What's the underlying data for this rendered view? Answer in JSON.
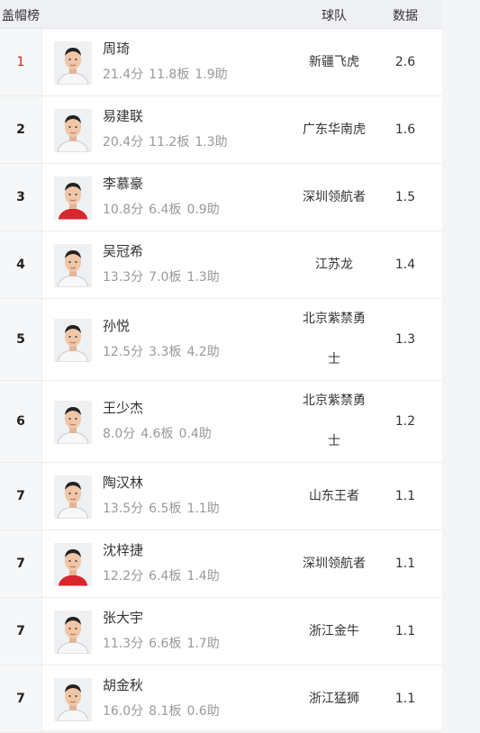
{
  "header": {
    "rank_title": "盖帽榜",
    "team_title": "球队",
    "stat_title": "数据"
  },
  "colors": {
    "top_rank": "#c0262c",
    "stat_text": "#999999",
    "header_bg": "#eef0f3"
  },
  "rows": [
    {
      "rank": "1",
      "name": "周琦",
      "pts": "21.4分",
      "reb": "11.8板",
      "ast": "1.9助",
      "team": "新疆飞虎",
      "stat": "2.6",
      "jersey": "white"
    },
    {
      "rank": "2",
      "name": "易建联",
      "pts": "20.4分",
      "reb": "11.2板",
      "ast": "1.3助",
      "team": "广东华南虎",
      "stat": "1.6",
      "jersey": "white"
    },
    {
      "rank": "3",
      "name": "李慕豪",
      "pts": "10.8分",
      "reb": "6.4板",
      "ast": "0.9助",
      "team": "深圳领航者",
      "stat": "1.5",
      "jersey": "red"
    },
    {
      "rank": "4",
      "name": "吴冠希",
      "pts": "13.3分",
      "reb": "7.0板",
      "ast": "1.3助",
      "team": "江苏龙",
      "stat": "1.4",
      "jersey": "white"
    },
    {
      "rank": "5",
      "name": "孙悦",
      "pts": "12.5分",
      "reb": "3.3板",
      "ast": "4.2助",
      "team": "北京紫禁勇士",
      "stat": "1.3",
      "jersey": "white"
    },
    {
      "rank": "6",
      "name": "王少杰",
      "pts": "8.0分",
      "reb": "4.6板",
      "ast": "0.4助",
      "team": "北京紫禁勇士",
      "stat": "1.2",
      "jersey": "white"
    },
    {
      "rank": "7",
      "name": "陶汉林",
      "pts": "13.5分",
      "reb": "6.5板",
      "ast": "1.1助",
      "team": "山东王者",
      "stat": "1.1",
      "jersey": "white"
    },
    {
      "rank": "7",
      "name": "沈梓捷",
      "pts": "12.2分",
      "reb": "6.4板",
      "ast": "1.4助",
      "team": "深圳领航者",
      "stat": "1.1",
      "jersey": "red"
    },
    {
      "rank": "7",
      "name": "张大宇",
      "pts": "11.3分",
      "reb": "6.6板",
      "ast": "1.7助",
      "team": "浙江金牛",
      "stat": "1.1",
      "jersey": "white"
    },
    {
      "rank": "7",
      "name": "胡金秋",
      "pts": "16.0分",
      "reb": "8.1板",
      "ast": "0.6助",
      "team": "浙江猛狮",
      "stat": "1.1",
      "jersey": "white"
    }
  ]
}
